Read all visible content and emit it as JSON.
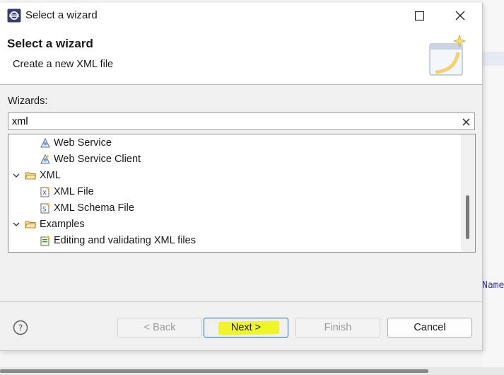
{
  "window": {
    "title": "Select a wizard"
  },
  "header": {
    "title": "Select a wizard",
    "description": "Create a new XML file"
  },
  "wizards": {
    "label": "Wizards:",
    "search_value": "xml"
  },
  "tree": {
    "items": [
      {
        "label": "Web Service",
        "icon": "web-service-icon"
      },
      {
        "label": "Web Service Client",
        "icon": "web-service-client-icon"
      },
      {
        "label": "XML",
        "icon": "folder-icon",
        "expanded": true
      },
      {
        "label": "XML File",
        "icon": "xml-file-icon",
        "selected": true
      },
      {
        "label": "XML Schema File",
        "icon": "xml-schema-file-icon"
      },
      {
        "label": "Examples",
        "icon": "folder-icon",
        "expanded": true
      },
      {
        "label": "Editing and validating XML files",
        "icon": "example-icon"
      }
    ]
  },
  "buttons": {
    "back": "< Back",
    "next": "Next >",
    "finish": "Finish",
    "cancel": "Cancel"
  },
  "background": {
    "partial_text": "Name"
  },
  "colors": {
    "highlight": "#eef52a",
    "focus_border": "#1a6cc4",
    "code_text": "#3a3aa8"
  }
}
